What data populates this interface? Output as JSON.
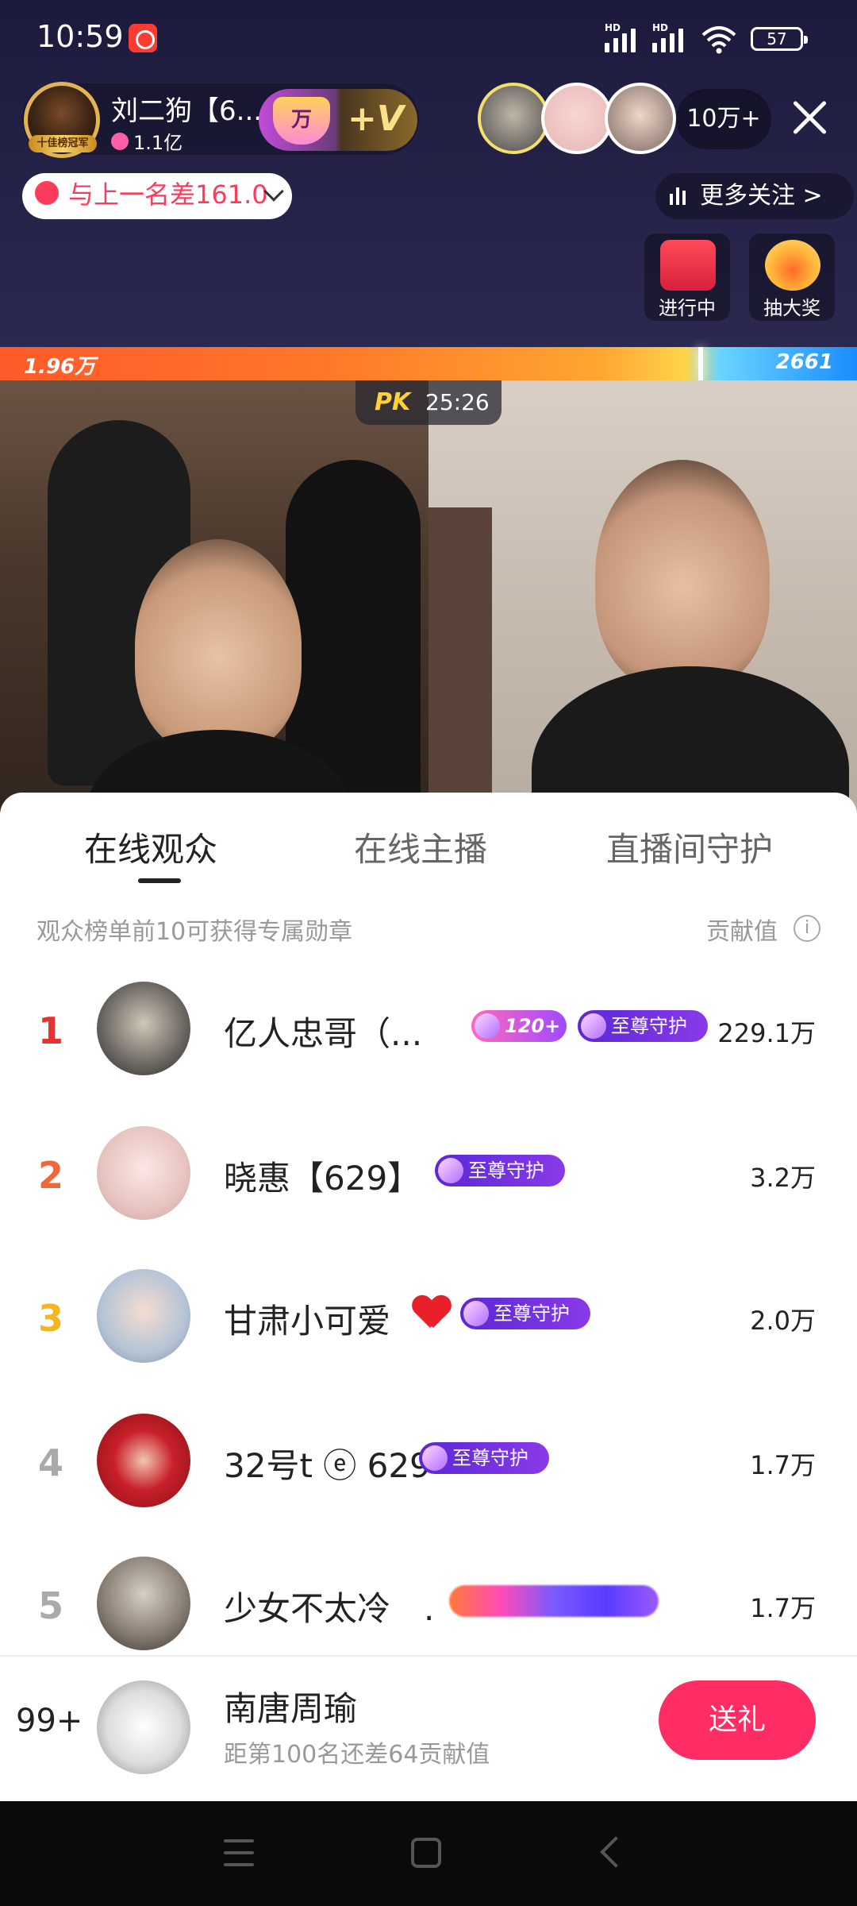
{
  "status_bar": {
    "time": "10:59",
    "battery": "57",
    "signal_label_1": "HD",
    "signal_label_2": "HD"
  },
  "host": {
    "name": "刘二狗【6...",
    "fans": "1.1亿",
    "avatar_tag": "十佳榜冠军",
    "badge_wan": "万",
    "badge_v": "+V"
  },
  "viewers": {
    "count": "10万+"
  },
  "rank_notice": "与上一名差161.0",
  "more_follow": "更多关注 >",
  "activities": [
    {
      "label": "进行中"
    },
    {
      "label": "抽大奖"
    }
  ],
  "pk": {
    "left_score": "1.96万",
    "right_score": "2661",
    "logo": "PK",
    "timer": "25:26"
  },
  "tabs": [
    {
      "label": "在线观众",
      "active": true
    },
    {
      "label": "在线主播",
      "active": false
    },
    {
      "label": "直播间守护",
      "active": false
    }
  ],
  "list_hint": "观众榜单前10可获得专属勋章",
  "contrib_label": "贡献值",
  "audience": [
    {
      "rank": "1",
      "name": "亿人忠哥（...",
      "level_badge": "120+",
      "guard_badge": "至尊守护",
      "value": "229.1万"
    },
    {
      "rank": "2",
      "name": "晓惠【629】",
      "guard_badge": "至尊守护",
      "value": "3.2万"
    },
    {
      "rank": "3",
      "name": "甘肃小可爱",
      "guard_badge": "至尊守护",
      "value": "2.0万"
    },
    {
      "rank": "4",
      "name": "32号t ⓔ 629",
      "guard_badge": "至尊守护",
      "value": "1.7万"
    },
    {
      "rank": "5",
      "name": "少女不太冷　.",
      "value": "1.7万"
    }
  ],
  "self": {
    "rank": "99+",
    "name": "南唐周瑜",
    "sub": "距第100名还差64贡献值",
    "gift_button": "送礼"
  },
  "colors": {
    "rank1": "#e8322f",
    "rank2": "#f0683a",
    "rank3": "#f5b51e",
    "rank_other": "#aaaaaa",
    "gift": "#ff2d63"
  }
}
